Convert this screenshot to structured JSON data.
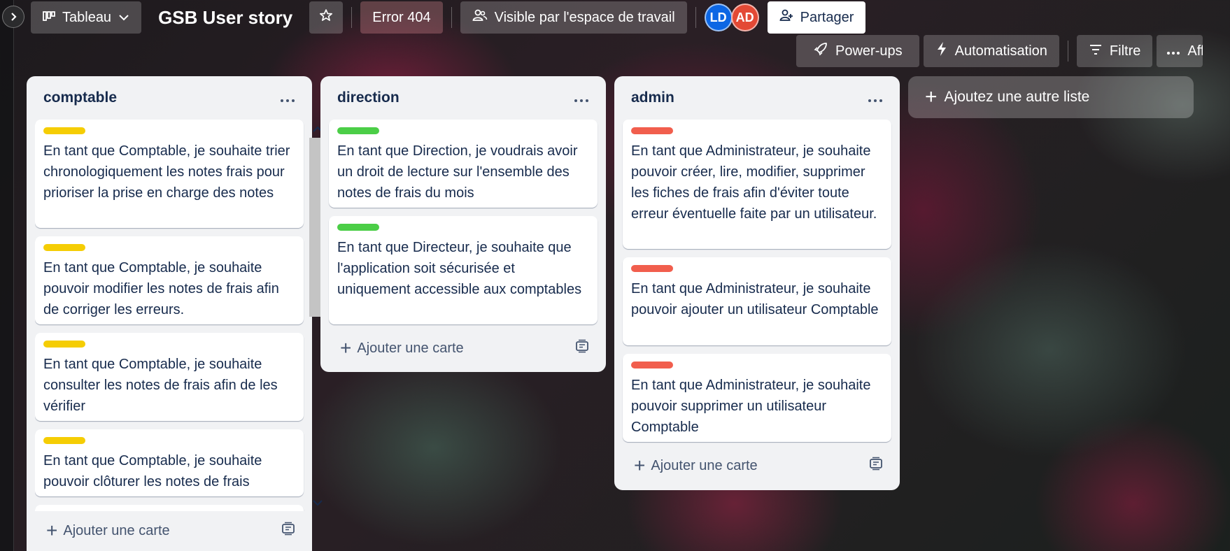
{
  "header": {
    "view_label": "Tableau",
    "board_title": "GSB User story",
    "error_badge": "Error 404",
    "visibility": "Visible par l'espace de travail",
    "members": [
      {
        "initials": "LD",
        "color": "#0c66e4"
      },
      {
        "initials": "AD",
        "color": "#e34935"
      }
    ],
    "share": "Partager"
  },
  "toolbar": {
    "powerups": "Power-ups",
    "automation": "Automatisation",
    "filter": "Filtre",
    "view_more": "Aff"
  },
  "lists": [
    {
      "title": "comptable",
      "label_color": "#f5cd04",
      "cards": [
        "En tant que Comptable, je souhaite trier chronologiquement les notes frais pour prioriser la prise en charge des notes",
        "En tant que Comptable, je souhaite pouvoir modifier les notes de frais afin de corriger les erreurs.",
        "En tant que Comptable, je souhaite consulter les notes de frais afin de les vérifier",
        "En tant que Comptable, je souhaite pouvoir clôturer les notes de frais"
      ],
      "add_card": "Ajouter une carte"
    },
    {
      "title": "direction",
      "label_color": "#4bce47",
      "cards": [
        "En tant que Direction, je voudrais avoir un droit de lecture sur l'ensemble des notes de frais du mois",
        "En tant que Directeur, je souhaite que l'application soit sécurisée et uniquement accessible aux comptables"
      ],
      "add_card": "Ajouter une carte"
    },
    {
      "title": "admin",
      "label_color": "#f15e4d",
      "cards": [
        "En tant que Administrateur, je souhaite pouvoir créer, lire, modifier, supprimer les fiches de frais afin d'éviter toute erreur éventuelle faite par un utilisateur.",
        "En tant que Administrateur, je souhaite pouvoir ajouter un utilisateur Comptable",
        "En tant que Administrateur, je souhaite pouvoir supprimer un utilisateur Comptable"
      ],
      "add_card": "Ajouter une carte"
    }
  ],
  "add_list": "Ajoutez une autre liste"
}
